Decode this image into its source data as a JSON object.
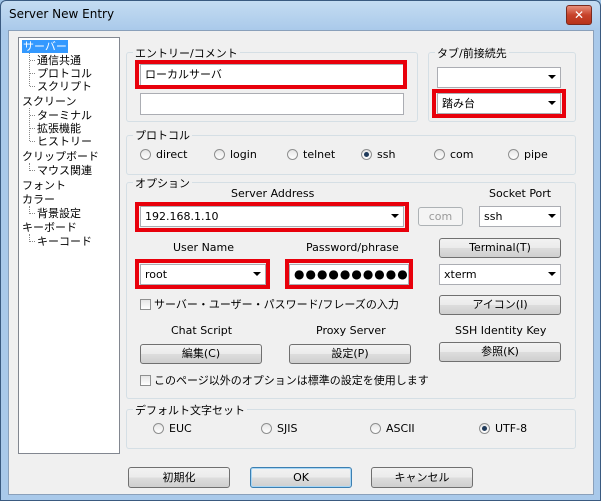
{
  "window": {
    "title": "Server New Entry",
    "close_glyph": "✕"
  },
  "tree": [
    {
      "label": "サーバー",
      "selected": true
    },
    {
      "label": "通信共通"
    },
    {
      "label": "プロトコル"
    },
    {
      "label": "スクリプト"
    },
    {
      "label": "スクリーン"
    },
    {
      "label": "ターミナル"
    },
    {
      "label": "拡張機能"
    },
    {
      "label": "ヒストリー"
    },
    {
      "label": "クリップボード"
    },
    {
      "label": "マウス関連"
    },
    {
      "label": "フォント"
    },
    {
      "label": "カラー"
    },
    {
      "label": "背景設定"
    },
    {
      "label": "キーボード"
    },
    {
      "label": "キーコード"
    }
  ],
  "entry": {
    "label": "エントリー/コメント",
    "name_value": "ローカルサーバ",
    "comment_value": ""
  },
  "tab": {
    "label": "タブ/前接続先",
    "tab_value": "",
    "prev_value": "踏み台"
  },
  "protocol": {
    "label": "プロトコル",
    "options": [
      "direct",
      "login",
      "telnet",
      "ssh",
      "com",
      "pipe"
    ],
    "selected": "ssh"
  },
  "options": {
    "label": "オプション",
    "server_address_label": "Server Address",
    "server_address_value": "192.168.1.10",
    "com_button": "com",
    "socket_port_label": "Socket Port",
    "socket_port_value": "ssh",
    "user_name_label": "User Name",
    "user_name_value": "root",
    "password_label": "Password/phrase",
    "password_value": "●●●●●●●●●●",
    "terminal_button": "Terminal(T)",
    "terminal_value": "xterm",
    "input_checkbox_label": "サーバー・ユーザー・パスワード/フレーズの入力",
    "icon_button": "アイコン(I)",
    "chat_script_label": "Chat Script",
    "proxy_server_label": "Proxy Server",
    "ssh_identity_label": "SSH Identity Key",
    "edit_button": "編集(C)",
    "settings_button": "設定(P)",
    "browse_button": "参照(K)",
    "default_checkbox_label": "このページ以外のオプションは標準の設定を使用します"
  },
  "charset": {
    "label": "デフォルト文字セット",
    "options": [
      "EUC",
      "SJIS",
      "ASCII",
      "UTF-8"
    ],
    "selected": "UTF-8"
  },
  "footer": {
    "init_button": "初期化",
    "ok_button": "OK",
    "cancel_button": "キャンセル"
  },
  "colors": {
    "highlight_red": "#e8000b",
    "selection_blue": "#3399ff"
  }
}
